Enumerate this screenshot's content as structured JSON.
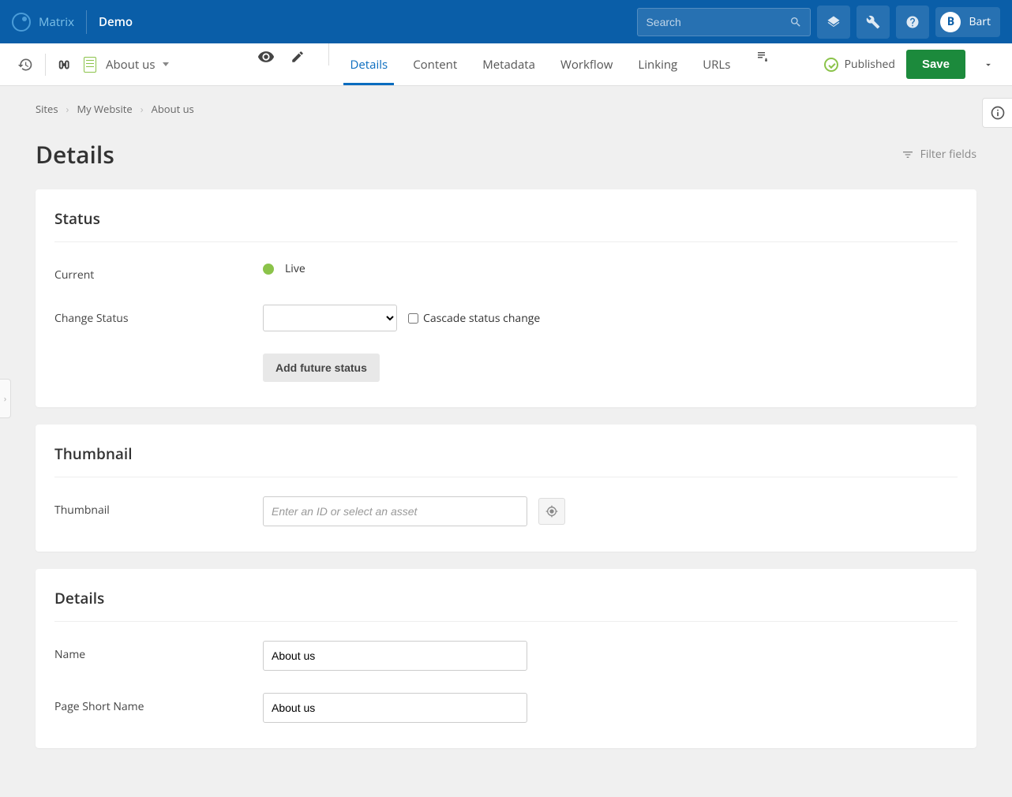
{
  "header": {
    "brand": "Matrix",
    "site": "Demo",
    "search_placeholder": "Search",
    "user": {
      "initial": "B",
      "name": "Bart"
    }
  },
  "toolbar": {
    "asset_title": "About us",
    "tabs": [
      "Details",
      "Content",
      "Metadata",
      "Workflow",
      "Linking",
      "URLs"
    ],
    "active_tab": "Details",
    "publish_status": "Published",
    "save_label": "Save"
  },
  "breadcrumb": [
    "Sites",
    "My Website",
    "About us"
  ],
  "page": {
    "heading": "Details",
    "filter_label": "Filter fields"
  },
  "sections": {
    "status": {
      "title": "Status",
      "current_label": "Current",
      "current_value": "Live",
      "change_label": "Change Status",
      "cascade_label": "Cascade status change",
      "add_future_label": "Add future status"
    },
    "thumbnail": {
      "title": "Thumbnail",
      "label": "Thumbnail",
      "placeholder": "Enter an ID or select an asset"
    },
    "details": {
      "title": "Details",
      "name_label": "Name",
      "name_value": "About us",
      "short_name_label": "Page Short Name",
      "short_name_value": "About us"
    }
  }
}
